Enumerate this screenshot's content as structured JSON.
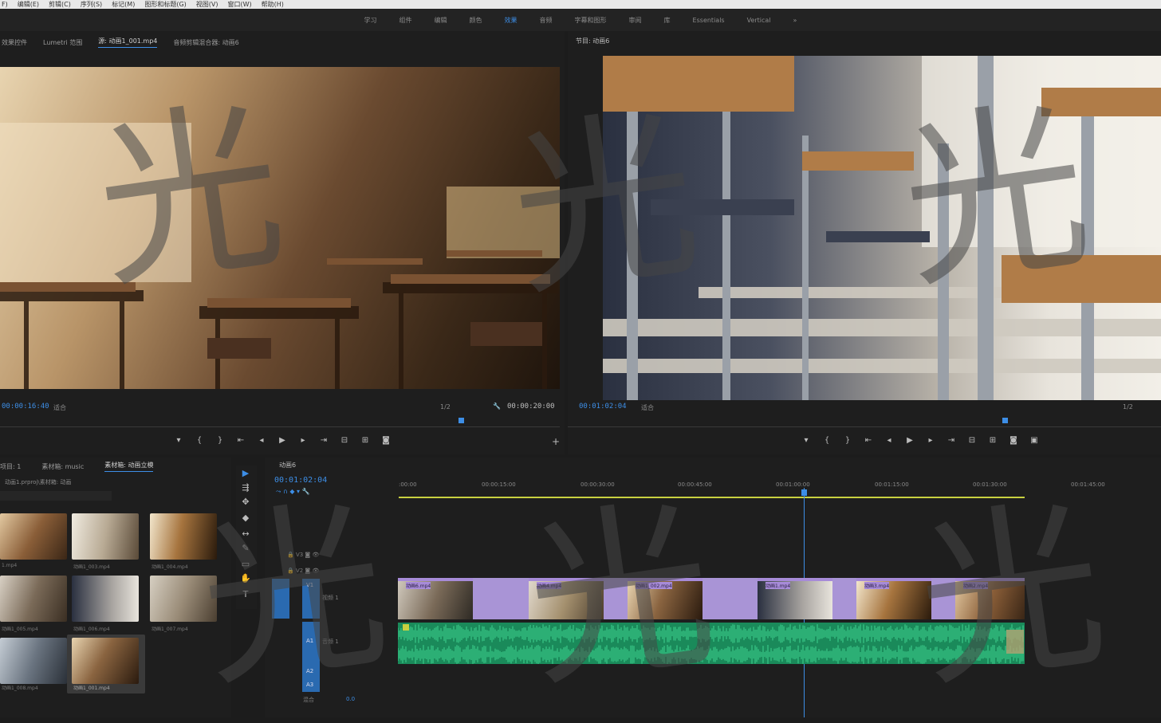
{
  "menu": [
    "F)",
    "编辑(E)",
    "剪辑(C)",
    "序列(S)",
    "标记(M)",
    "图形和标题(G)",
    "视图(V)",
    "窗口(W)",
    "帮助(H)"
  ],
  "workspaces": [
    "学习",
    "组件",
    "编辑",
    "颜色",
    "效果",
    "音频",
    "字幕和图形",
    "审阅",
    "库",
    "Essentials",
    "Vertical",
    "»"
  ],
  "source": {
    "tabs": [
      "效果控件",
      "Lumetri 范围",
      "源: 动画1_001.mp4",
      "音频剪辑混合器: 动画6"
    ],
    "timecode": "00:00:16:40",
    "fit": "适合",
    "res": "1/2",
    "duration": "00:00:20:00"
  },
  "program": {
    "tab": "节目: 动画6",
    "timecode": "00:01:02:04",
    "fit": "适合",
    "res": "1/2"
  },
  "project": {
    "tabs": [
      "项目: 1",
      "素材箱: music",
      "素材箱: 动画立模"
    ],
    "path": "动画1.prproj\\素材箱: 动画",
    "search_placeholder": "",
    "items": [
      "1.mp4",
      "动画1_003.mp4",
      "动画1_004.mp4",
      "动画1_005.mp4",
      "动画1_006.mp4",
      "动画1_007.mp4",
      "动画1_008.mp4",
      "动画1_001.mp4"
    ]
  },
  "timeline": {
    "tab": "动画6",
    "timecode": "00:01:02:04",
    "ruler": [
      ":00:00",
      "00:00:15:00",
      "00:00:30:00",
      "00:00:45:00",
      "00:01:00:00",
      "00:01:15:00",
      "00:01:30:00",
      "00:01:45:00"
    ],
    "tracks": {
      "v3": "V3",
      "v2": "V2",
      "v1": "V1",
      "v1name": "视频 1",
      "a1": "A1",
      "a1name": "音频 1",
      "a2": "A2",
      "a3": "A3",
      "mix": "混合",
      "mixval": "0.0"
    },
    "clips": [
      "动画6.mp4",
      "动画4.mp4",
      "动画1_002.mp4",
      "动画1.mp4",
      "动画3.mp4",
      "动画2.mp4"
    ]
  },
  "watermark": "光"
}
